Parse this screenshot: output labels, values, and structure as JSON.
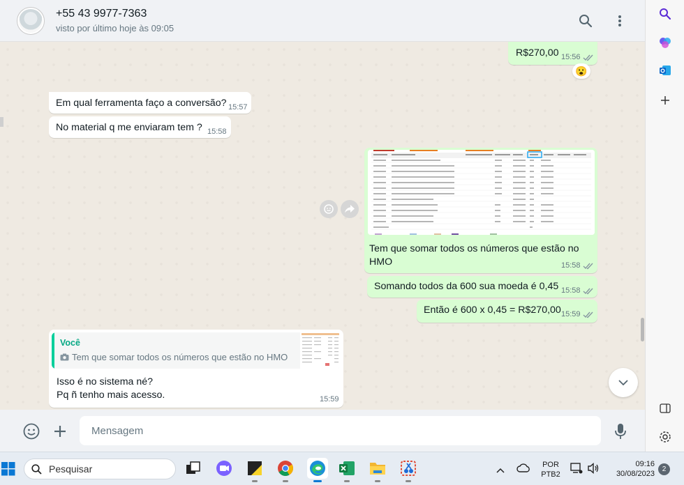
{
  "header": {
    "contact_name": "+55 43 9977-7363",
    "contact_status": "visto por último hoje às 09:05",
    "search_icon": "search-icon",
    "menu_icon": "kebab-menu-icon"
  },
  "messages": [
    {
      "direction": "out",
      "text": "R$270,00",
      "time": "15:56",
      "reaction": "😮"
    },
    {
      "direction": "in",
      "text": "Em qual ferramenta faço a conversão?",
      "time": "15:57"
    },
    {
      "direction": "in",
      "text": "No material q me enviaram tem ?",
      "time": "15:58"
    },
    {
      "direction": "out",
      "type": "image",
      "caption_line1": "Tem que somar todos os números que estão no",
      "caption_line2": "HMO",
      "time": "15:58"
    },
    {
      "direction": "out",
      "text": "Somando todos da 600 sua moeda é 0,45",
      "time": "15:58"
    },
    {
      "direction": "out",
      "text": "Então é 600 x 0,45 = R$270,00",
      "time": "15:59"
    },
    {
      "direction": "in",
      "quote_author": "Você",
      "quote_text": "Tem que somar todos os números que estão no HMO",
      "line1": "Isso é no sistema né?",
      "line2": "Pq ñ tenho mais acesso.",
      "time": "15:59"
    }
  ],
  "composer": {
    "placeholder": "Mensagem"
  },
  "taskbar": {
    "search_label": "Pesquisar",
    "language_line1": "POR",
    "language_line2": "PTB2",
    "time": "09:16",
    "date": "30/08/2023",
    "notification_count": "2"
  },
  "colors": {
    "outgoing_bubble": "#d9fdd3",
    "incoming_bubble": "#ffffff",
    "chat_background": "#efeae2",
    "accent": "#06cf9c",
    "read_ticks": "#53bdeb"
  }
}
